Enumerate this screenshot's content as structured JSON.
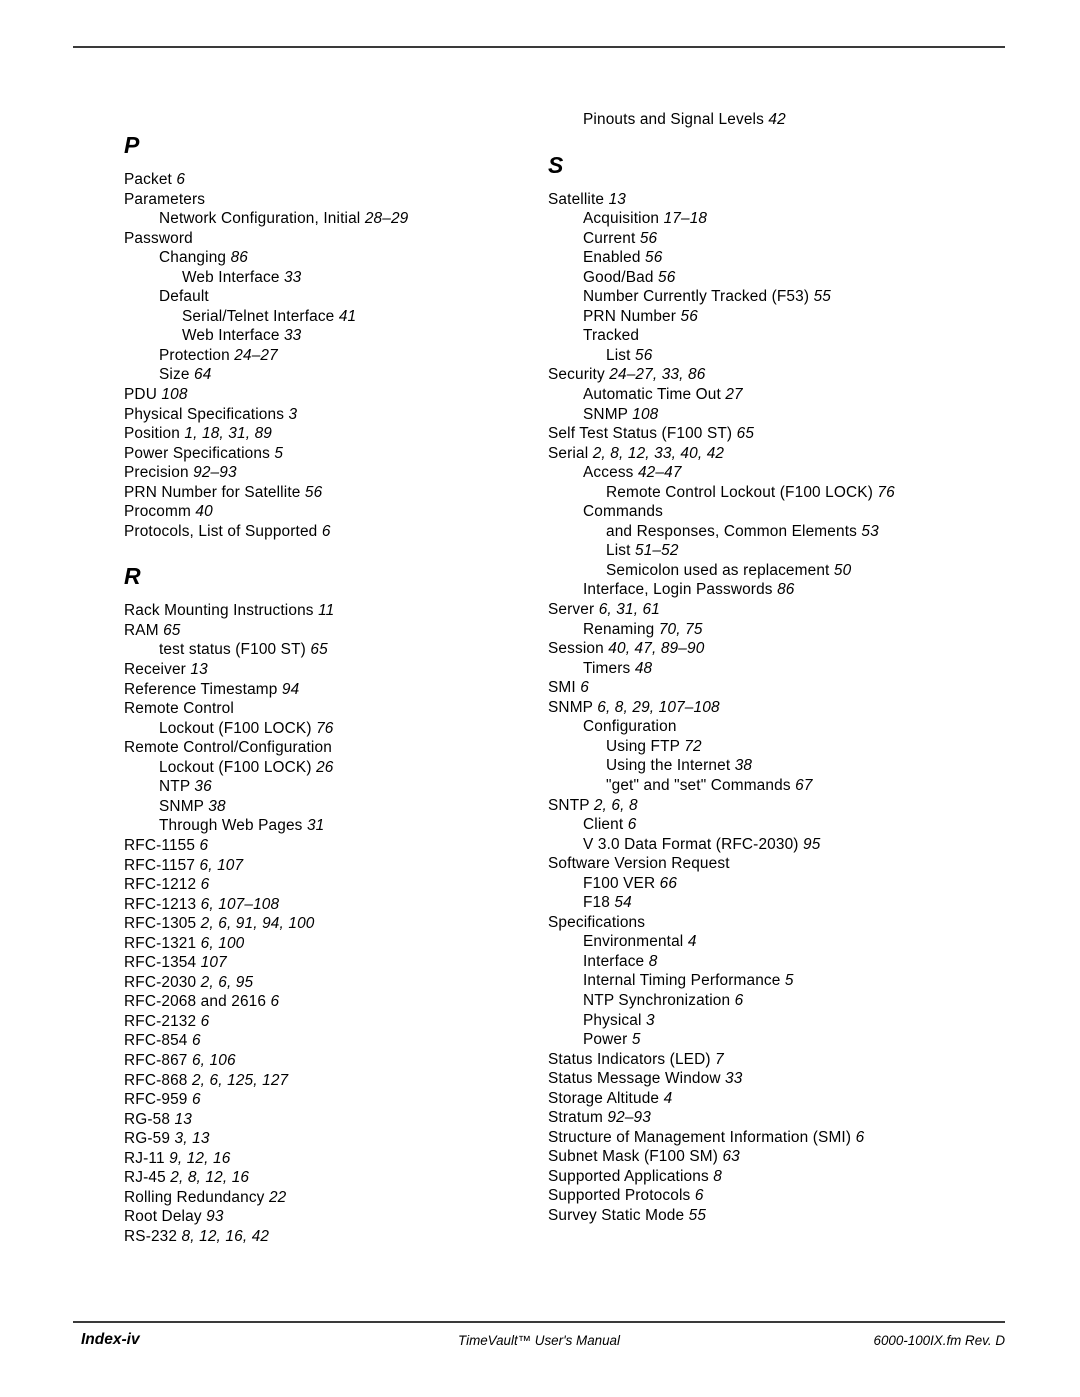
{
  "document": {
    "page_label": "Index-iv",
    "manual_title": "TimeVault™ User's Manual",
    "file_revision": "6000-100IX.fm  Rev. D"
  },
  "columns": {
    "left": {
      "blocks": [
        {
          "type": "letter",
          "letter": "P"
        },
        {
          "type": "entries",
          "items": [
            {
              "level": 0,
              "text": "Packet ",
              "pages": "6"
            },
            {
              "level": 0,
              "text": "Parameters",
              "pages": ""
            },
            {
              "level": 1,
              "text": "Network Configuration, Initial ",
              "pages": "28–29"
            },
            {
              "level": 0,
              "text": "Password",
              "pages": ""
            },
            {
              "level": 1,
              "text": "Changing ",
              "pages": "86"
            },
            {
              "level": 2,
              "text": "Web Interface ",
              "pages": "33"
            },
            {
              "level": 1,
              "text": "Default",
              "pages": ""
            },
            {
              "level": 2,
              "text": "Serial/Telnet Interface ",
              "pages": "41"
            },
            {
              "level": 2,
              "text": "Web Interface ",
              "pages": "33"
            },
            {
              "level": 1,
              "text": "Protection ",
              "pages": "24–27"
            },
            {
              "level": 1,
              "text": "Size ",
              "pages": "64"
            },
            {
              "level": 0,
              "text": "PDU ",
              "pages": "108"
            },
            {
              "level": 0,
              "text": "Physical Specifications ",
              "pages": "3"
            },
            {
              "level": 0,
              "text": "Position ",
              "pages": "1, 18, 31, 89"
            },
            {
              "level": 0,
              "text": "Power Specifications ",
              "pages": "5"
            },
            {
              "level": 0,
              "text": "Precision ",
              "pages": "92–93"
            },
            {
              "level": 0,
              "text": "PRN Number for Satellite ",
              "pages": "56"
            },
            {
              "level": 0,
              "text": "Procomm ",
              "pages": "40"
            },
            {
              "level": 0,
              "text": "Protocols, List of Supported ",
              "pages": "6"
            }
          ]
        },
        {
          "type": "letter",
          "letter": "R"
        },
        {
          "type": "entries",
          "items": [
            {
              "level": 0,
              "text": "Rack Mounting Instructions ",
              "pages": "11"
            },
            {
              "level": 0,
              "text": "RAM ",
              "pages": "65"
            },
            {
              "level": 1,
              "text": "test status (F100 ST) ",
              "pages": "65"
            },
            {
              "level": 0,
              "text": "Receiver ",
              "pages": "13"
            },
            {
              "level": 0,
              "text": "Reference Timestamp ",
              "pages": "94"
            },
            {
              "level": 0,
              "text": "Remote Control",
              "pages": ""
            },
            {
              "level": 1,
              "text": "Lockout (F100 LOCK) ",
              "pages": "76"
            },
            {
              "level": 0,
              "text": "Remote Control/Configuration",
              "pages": ""
            },
            {
              "level": 1,
              "text": "Lockout (F100 LOCK) ",
              "pages": "26"
            },
            {
              "level": 1,
              "text": "NTP ",
              "pages": "36"
            },
            {
              "level": 1,
              "text": "SNMP ",
              "pages": "38"
            },
            {
              "level": 1,
              "text": "Through Web Pages ",
              "pages": "31"
            },
            {
              "level": 0,
              "text": "RFC-1155 ",
              "pages": "6"
            },
            {
              "level": 0,
              "text": "RFC-1157 ",
              "pages": "6, 107"
            },
            {
              "level": 0,
              "text": "RFC-1212 ",
              "pages": "6"
            },
            {
              "level": 0,
              "text": "RFC-1213 ",
              "pages": "6, 107–108"
            },
            {
              "level": 0,
              "text": "RFC-1305 ",
              "pages": "2, 6, 91, 94, 100"
            },
            {
              "level": 0,
              "text": "RFC-1321 ",
              "pages": "6, 100"
            },
            {
              "level": 0,
              "text": "RFC-1354 ",
              "pages": "107"
            },
            {
              "level": 0,
              "text": "RFC-2030 ",
              "pages": "2, 6, 95"
            },
            {
              "level": 0,
              "text": "RFC-2068 and 2616 ",
              "pages": "6"
            },
            {
              "level": 0,
              "text": "RFC-2132 ",
              "pages": "6"
            },
            {
              "level": 0,
              "text": "RFC-854 ",
              "pages": "6"
            },
            {
              "level": 0,
              "text": "RFC-867 ",
              "pages": "6, 106"
            },
            {
              "level": 0,
              "text": "RFC-868 ",
              "pages": "2, 6, 125, 127"
            },
            {
              "level": 0,
              "text": "RFC-959 ",
              "pages": "6"
            },
            {
              "level": 0,
              "text": "RG-58 ",
              "pages": "13"
            },
            {
              "level": 0,
              "text": "RG-59 ",
              "pages": "3, 13"
            },
            {
              "level": 0,
              "text": "RJ-11 ",
              "pages": "9, 12, 16"
            },
            {
              "level": 0,
              "text": "RJ-45 ",
              "pages": "2, 8, 12, 16"
            },
            {
              "level": 0,
              "text": "Rolling Redundancy ",
              "pages": "22"
            },
            {
              "level": 0,
              "text": "Root Delay ",
              "pages": "93"
            },
            {
              "level": 0,
              "text": "RS-232 ",
              "pages": "8, 12, 16, 42"
            }
          ]
        }
      ]
    },
    "right": {
      "blocks": [
        {
          "type": "entries",
          "items": [
            {
              "level": 1,
              "text": "Pinouts and Signal Levels ",
              "pages": "42"
            }
          ]
        },
        {
          "type": "letter",
          "letter": "S"
        },
        {
          "type": "entries",
          "items": [
            {
              "level": 0,
              "text": "Satellite ",
              "pages": "13"
            },
            {
              "level": 1,
              "text": "Acquisition ",
              "pages": "17–18"
            },
            {
              "level": 1,
              "text": "Current ",
              "pages": "56"
            },
            {
              "level": 1,
              "text": "Enabled ",
              "pages": "56"
            },
            {
              "level": 1,
              "text": "Good/Bad ",
              "pages": "56"
            },
            {
              "level": 1,
              "text": "Number Currently Tracked (F53) ",
              "pages": "55"
            },
            {
              "level": 1,
              "text": "PRN Number ",
              "pages": "56"
            },
            {
              "level": 1,
              "text": "Tracked",
              "pages": ""
            },
            {
              "level": 2,
              "text": "List ",
              "pages": "56"
            },
            {
              "level": 0,
              "text": "Security ",
              "pages": "24–27, 33, 86"
            },
            {
              "level": 1,
              "text": "Automatic Time Out ",
              "pages": "27"
            },
            {
              "level": 1,
              "text": "SNMP ",
              "pages": "108"
            },
            {
              "level": 0,
              "text": "Self Test Status (F100 ST) ",
              "pages": "65"
            },
            {
              "level": 0,
              "text": "Serial ",
              "pages": "2, 8, 12, 33, 40, 42"
            },
            {
              "level": 1,
              "text": "Access ",
              "pages": "42–47"
            },
            {
              "level": 2,
              "text": "Remote Control Lockout (F100 LOCK) ",
              "pages": "76"
            },
            {
              "level": 1,
              "text": "Commands",
              "pages": ""
            },
            {
              "level": 2,
              "text": "and Responses, Common Elements ",
              "pages": "53"
            },
            {
              "level": 2,
              "text": "List ",
              "pages": "51–52"
            },
            {
              "level": 2,
              "text": "Semicolon used as replacement ",
              "pages": "50"
            },
            {
              "level": 1,
              "text": "Interface, Login Passwords ",
              "pages": "86"
            },
            {
              "level": 0,
              "text": "Server ",
              "pages": "6, 31, 61"
            },
            {
              "level": 1,
              "text": "Renaming ",
              "pages": "70, 75"
            },
            {
              "level": 0,
              "text": "Session ",
              "pages": "40, 47, 89–90"
            },
            {
              "level": 1,
              "text": "Timers ",
              "pages": "48"
            },
            {
              "level": 0,
              "text": "SMI ",
              "pages": "6"
            },
            {
              "level": 0,
              "text": "SNMP ",
              "pages": "6, 8, 29, 107–108"
            },
            {
              "level": 1,
              "text": "Configuration",
              "pages": ""
            },
            {
              "level": 2,
              "text": "Using FTP ",
              "pages": "72"
            },
            {
              "level": 2,
              "text": "Using the Internet ",
              "pages": "38"
            },
            {
              "level": 2,
              "text": "\"get\" and \"set\" Commands ",
              "pages": "67"
            },
            {
              "level": 0,
              "text": "SNTP ",
              "pages": "2, 6, 8"
            },
            {
              "level": 1,
              "text": "Client ",
              "pages": "6"
            },
            {
              "level": 1,
              "text": "V 3.0 Data Format (RFC-2030) ",
              "pages": "95"
            },
            {
              "level": 0,
              "text": "Software Version Request",
              "pages": ""
            },
            {
              "level": 1,
              "text": "F100 VER ",
              "pages": "66"
            },
            {
              "level": 1,
              "text": "F18 ",
              "pages": "54"
            },
            {
              "level": 0,
              "text": "Specifications",
              "pages": ""
            },
            {
              "level": 1,
              "text": "Environmental ",
              "pages": "4"
            },
            {
              "level": 1,
              "text": "Interface ",
              "pages": "8"
            },
            {
              "level": 1,
              "text": "Internal Timing Performance ",
              "pages": "5"
            },
            {
              "level": 1,
              "text": "NTP Synchronization ",
              "pages": "6"
            },
            {
              "level": 1,
              "text": "Physical ",
              "pages": "3"
            },
            {
              "level": 1,
              "text": "Power ",
              "pages": "5"
            },
            {
              "level": 0,
              "text": "Status Indicators (LED) ",
              "pages": "7"
            },
            {
              "level": 0,
              "text": "Status Message Window ",
              "pages": "33"
            },
            {
              "level": 0,
              "text": "Storage Altitude ",
              "pages": "4"
            },
            {
              "level": 0,
              "text": "Stratum ",
              "pages": "92–93"
            },
            {
              "level": 0,
              "text": "Structure of Management Information (SMI) ",
              "pages": "6"
            },
            {
              "level": 0,
              "text": "Subnet Mask (F100 SM) ",
              "pages": "63"
            },
            {
              "level": 0,
              "text": "Supported Applications ",
              "pages": "8"
            },
            {
              "level": 0,
              "text": "Supported Protocols ",
              "pages": "6"
            },
            {
              "level": 0,
              "text": "Survey Static Mode ",
              "pages": "55"
            }
          ]
        }
      ]
    }
  }
}
